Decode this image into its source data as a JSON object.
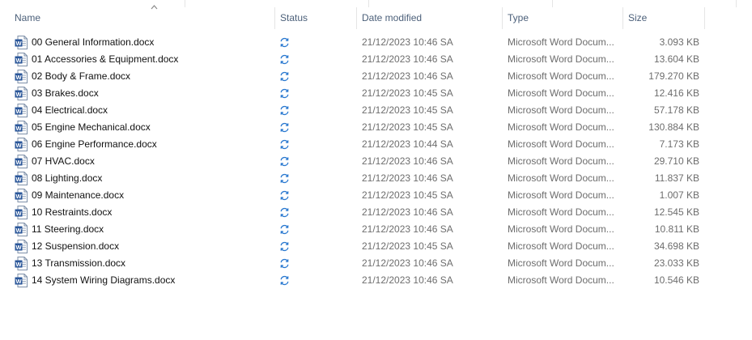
{
  "columns": {
    "name": "Name",
    "status": "Status",
    "date": "Date modified",
    "type": "Type",
    "size": "Size"
  },
  "sort": {
    "column": "name",
    "icon": "sort-up-arrow-icon"
  },
  "colors": {
    "header_text": "#4c607a",
    "word_blue": "#2b579a",
    "sync_blue": "#2a79d0"
  },
  "files": [
    {
      "name": "00 General Information.docx",
      "date": "21/12/2023 10:46 SA",
      "type": "Microsoft Word Docum...",
      "size": "3.093 KB",
      "status_icon": "sync-pending-icon"
    },
    {
      "name": "01 Accessories & Equipment.docx",
      "date": "21/12/2023 10:46 SA",
      "type": "Microsoft Word Docum...",
      "size": "13.604 KB",
      "status_icon": "sync-pending-icon"
    },
    {
      "name": "02 Body & Frame.docx",
      "date": "21/12/2023 10:46 SA",
      "type": "Microsoft Word Docum...",
      "size": "179.270 KB",
      "status_icon": "sync-pending-icon"
    },
    {
      "name": "03 Brakes.docx",
      "date": "21/12/2023 10:45 SA",
      "type": "Microsoft Word Docum...",
      "size": "12.416 KB",
      "status_icon": "sync-pending-icon"
    },
    {
      "name": "04 Electrical.docx",
      "date": "21/12/2023 10:45 SA",
      "type": "Microsoft Word Docum...",
      "size": "57.178 KB",
      "status_icon": "sync-pending-icon"
    },
    {
      "name": "05 Engine Mechanical.docx",
      "date": "21/12/2023 10:45 SA",
      "type": "Microsoft Word Docum...",
      "size": "130.884 KB",
      "status_icon": "sync-pending-icon"
    },
    {
      "name": "06 Engine Performance.docx",
      "date": "21/12/2023 10:44 SA",
      "type": "Microsoft Word Docum...",
      "size": "7.173 KB",
      "status_icon": "sync-pending-icon"
    },
    {
      "name": "07 HVAC.docx",
      "date": "21/12/2023 10:46 SA",
      "type": "Microsoft Word Docum...",
      "size": "29.710 KB",
      "status_icon": "sync-pending-icon"
    },
    {
      "name": "08 Lighting.docx",
      "date": "21/12/2023 10:46 SA",
      "type": "Microsoft Word Docum...",
      "size": "11.837 KB",
      "status_icon": "sync-pending-icon"
    },
    {
      "name": "09 Maintenance.docx",
      "date": "21/12/2023 10:45 SA",
      "type": "Microsoft Word Docum...",
      "size": "1.007 KB",
      "status_icon": "sync-pending-icon"
    },
    {
      "name": "10 Restraints.docx",
      "date": "21/12/2023 10:46 SA",
      "type": "Microsoft Word Docum...",
      "size": "12.545 KB",
      "status_icon": "sync-pending-icon"
    },
    {
      "name": "11 Steering.docx",
      "date": "21/12/2023 10:46 SA",
      "type": "Microsoft Word Docum...",
      "size": "10.811 KB",
      "status_icon": "sync-pending-icon"
    },
    {
      "name": "12 Suspension.docx",
      "date": "21/12/2023 10:45 SA",
      "type": "Microsoft Word Docum...",
      "size": "34.698 KB",
      "status_icon": "sync-pending-icon"
    },
    {
      "name": "13 Transmission.docx",
      "date": "21/12/2023 10:46 SA",
      "type": "Microsoft Word Docum...",
      "size": "23.033 KB",
      "status_icon": "sync-pending-icon"
    },
    {
      "name": "14 System Wiring Diagrams.docx",
      "date": "21/12/2023 10:46 SA",
      "type": "Microsoft Word Docum...",
      "size": "10.546 KB",
      "status_icon": "sync-pending-icon"
    }
  ]
}
